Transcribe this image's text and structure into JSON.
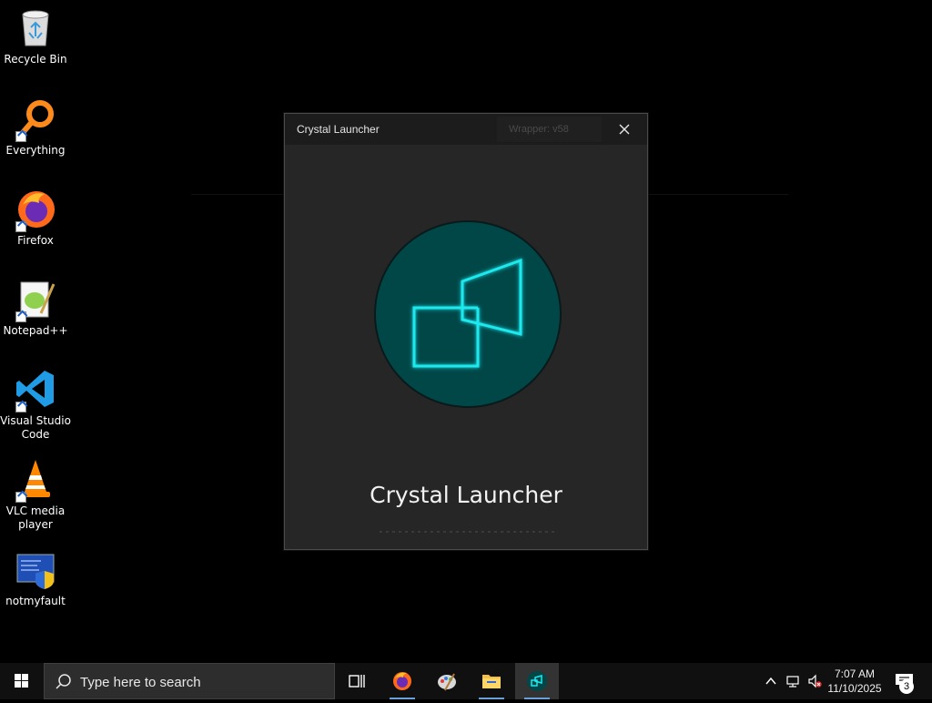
{
  "desktop": {
    "icons": [
      {
        "label": "Recycle Bin",
        "icon": "recycle-bin-icon"
      },
      {
        "label": "Everything",
        "icon": "everything-search-icon"
      },
      {
        "label": "Firefox",
        "icon": "firefox-icon"
      },
      {
        "label": "Notepad++",
        "icon": "notepad-plus-plus-icon"
      },
      {
        "label": "Visual Studio Code",
        "icon": "vscode-icon"
      },
      {
        "label": "VLC media player",
        "icon": "vlc-icon"
      },
      {
        "label": "notmyfault",
        "icon": "notmyfault-icon"
      }
    ]
  },
  "window": {
    "title": "Crystal Launcher",
    "wrapper_label": "Wrapper: v58",
    "app_name": "Crystal Launcher",
    "accent": "#1ee8ee",
    "logo_bg": "#014748"
  },
  "taskbar": {
    "search_placeholder": "Type here to search",
    "time": "7:07 AM",
    "date": "11/10/2025",
    "notification_count": "3"
  }
}
